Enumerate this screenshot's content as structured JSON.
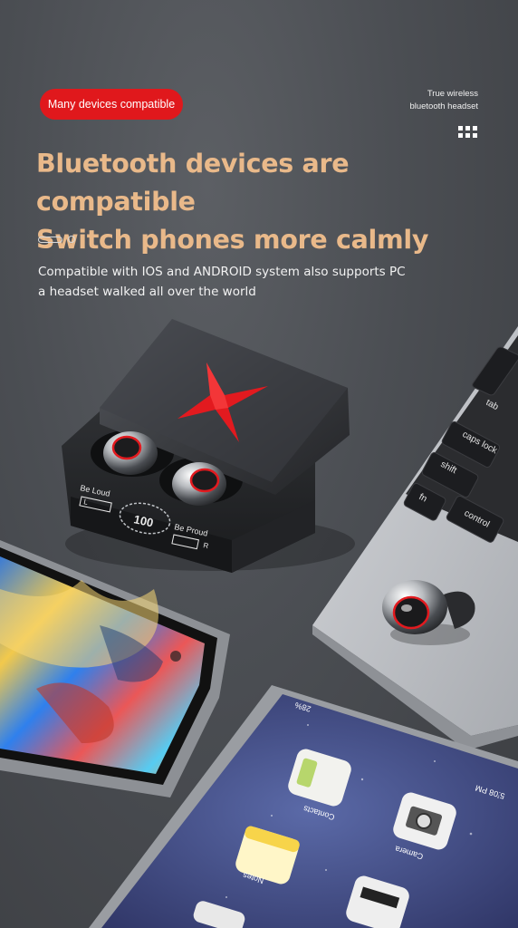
{
  "badge": {
    "label": "Many devices compatible"
  },
  "brand_tag": {
    "line1": "True wireless",
    "line2": "bluetooth headset"
  },
  "headline": {
    "line1": "Bluetooth devices are compatible",
    "line2": "Switch phones more calmly"
  },
  "description": {
    "line1": "Compatible with IOS and ANDROID system also supports PC",
    "line2": "a headset walked all over the world"
  },
  "case_display": {
    "left_label": "Be Loud",
    "left_letter": "L",
    "right_label": "Be Proud",
    "right_letter": "R",
    "battery_readout": "100"
  },
  "keyboard": {
    "keys": [
      "tab",
      "caps lock",
      "shift",
      "fn",
      "control"
    ]
  },
  "tablet": {
    "status_battery": "28%",
    "status_time": "5:08 PM",
    "apps": [
      "Contacts",
      "Camera",
      "Notes"
    ]
  },
  "colors": {
    "accent": "#e0181c",
    "headline": "#e9b98a"
  }
}
